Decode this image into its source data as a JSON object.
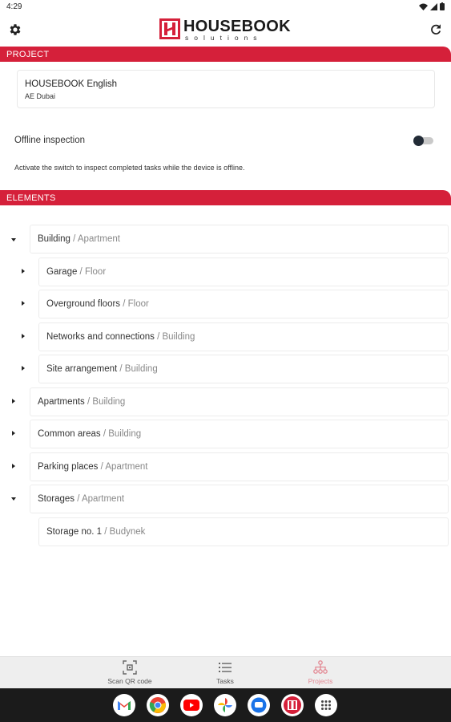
{
  "status_bar": {
    "time": "4:29"
  },
  "header": {
    "logo_brand": "HOUSEBOOK",
    "logo_tagline": "solutions"
  },
  "project_section": {
    "title": "PROJECT",
    "project_name": "HOUSEBOOK English",
    "project_location": "AE Dubai"
  },
  "offline": {
    "label": "Offline inspection",
    "enabled": false,
    "help": "Activate the switch to inspect completed tasks while the device is offline."
  },
  "elements_section": {
    "title": "ELEMENTS",
    "items": [
      {
        "name": "Building",
        "type": " / Apartment",
        "expanded": true
      },
      {
        "name": "Garage",
        "type": " / Floor",
        "expanded": false
      },
      {
        "name": "Overground floors",
        "type": " / Floor",
        "expanded": false
      },
      {
        "name": "Networks and connections",
        "type": " / Building",
        "expanded": false
      },
      {
        "name": "Site arrangement",
        "type": " / Building",
        "expanded": false
      },
      {
        "name": "Apartments",
        "type": " / Building",
        "expanded": false
      },
      {
        "name": "Common areas",
        "type": " / Building",
        "expanded": false
      },
      {
        "name": "Parking places",
        "type": " / Apartment",
        "expanded": false
      },
      {
        "name": "Storages",
        "type": " / Apartment",
        "expanded": true
      },
      {
        "name": "Storage no. 1",
        "type": " / Budynek",
        "expanded": false
      }
    ]
  },
  "bottom_nav": {
    "items": [
      {
        "label": "Scan QR code",
        "icon": "qr-scan-icon",
        "active": false
      },
      {
        "label": "Tasks",
        "icon": "list-icon",
        "active": false
      },
      {
        "label": "Projects",
        "icon": "hierarchy-icon",
        "active": true
      }
    ]
  },
  "dock": {
    "apps": [
      "gmail-icon",
      "chrome-icon",
      "youtube-icon",
      "photos-icon",
      "messages-icon",
      "housebook-app-icon",
      "app-drawer-icon"
    ]
  },
  "colors": {
    "brand_red": "#d5203a",
    "active_tab": "#e38a95",
    "toggle_thumb": "#222b36"
  }
}
